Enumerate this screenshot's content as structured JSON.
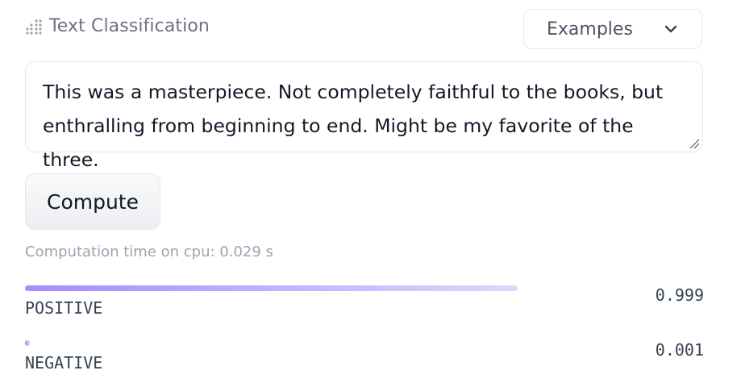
{
  "header": {
    "task_icon": "dotted-grid-icon",
    "task_label": "Text Classification"
  },
  "examples": {
    "label": "Examples",
    "icon": "chevron-down-icon"
  },
  "input": {
    "text": "This was a masterpiece. Not completely faithful to the books, but enthralling from beginning to end. Might be my favorite of the three."
  },
  "compute": {
    "label": "Compute"
  },
  "status": {
    "computation_time": "Computation time on cpu: 0.029 s"
  },
  "results": [
    {
      "label": "POSITIVE",
      "score": "0.999",
      "fraction": 0.999
    },
    {
      "label": "NEGATIVE",
      "score": "0.001",
      "fraction": 0.001
    }
  ],
  "colors": {
    "bar_start": "#a78bfa",
    "bar_end": "#ddd6fe"
  }
}
